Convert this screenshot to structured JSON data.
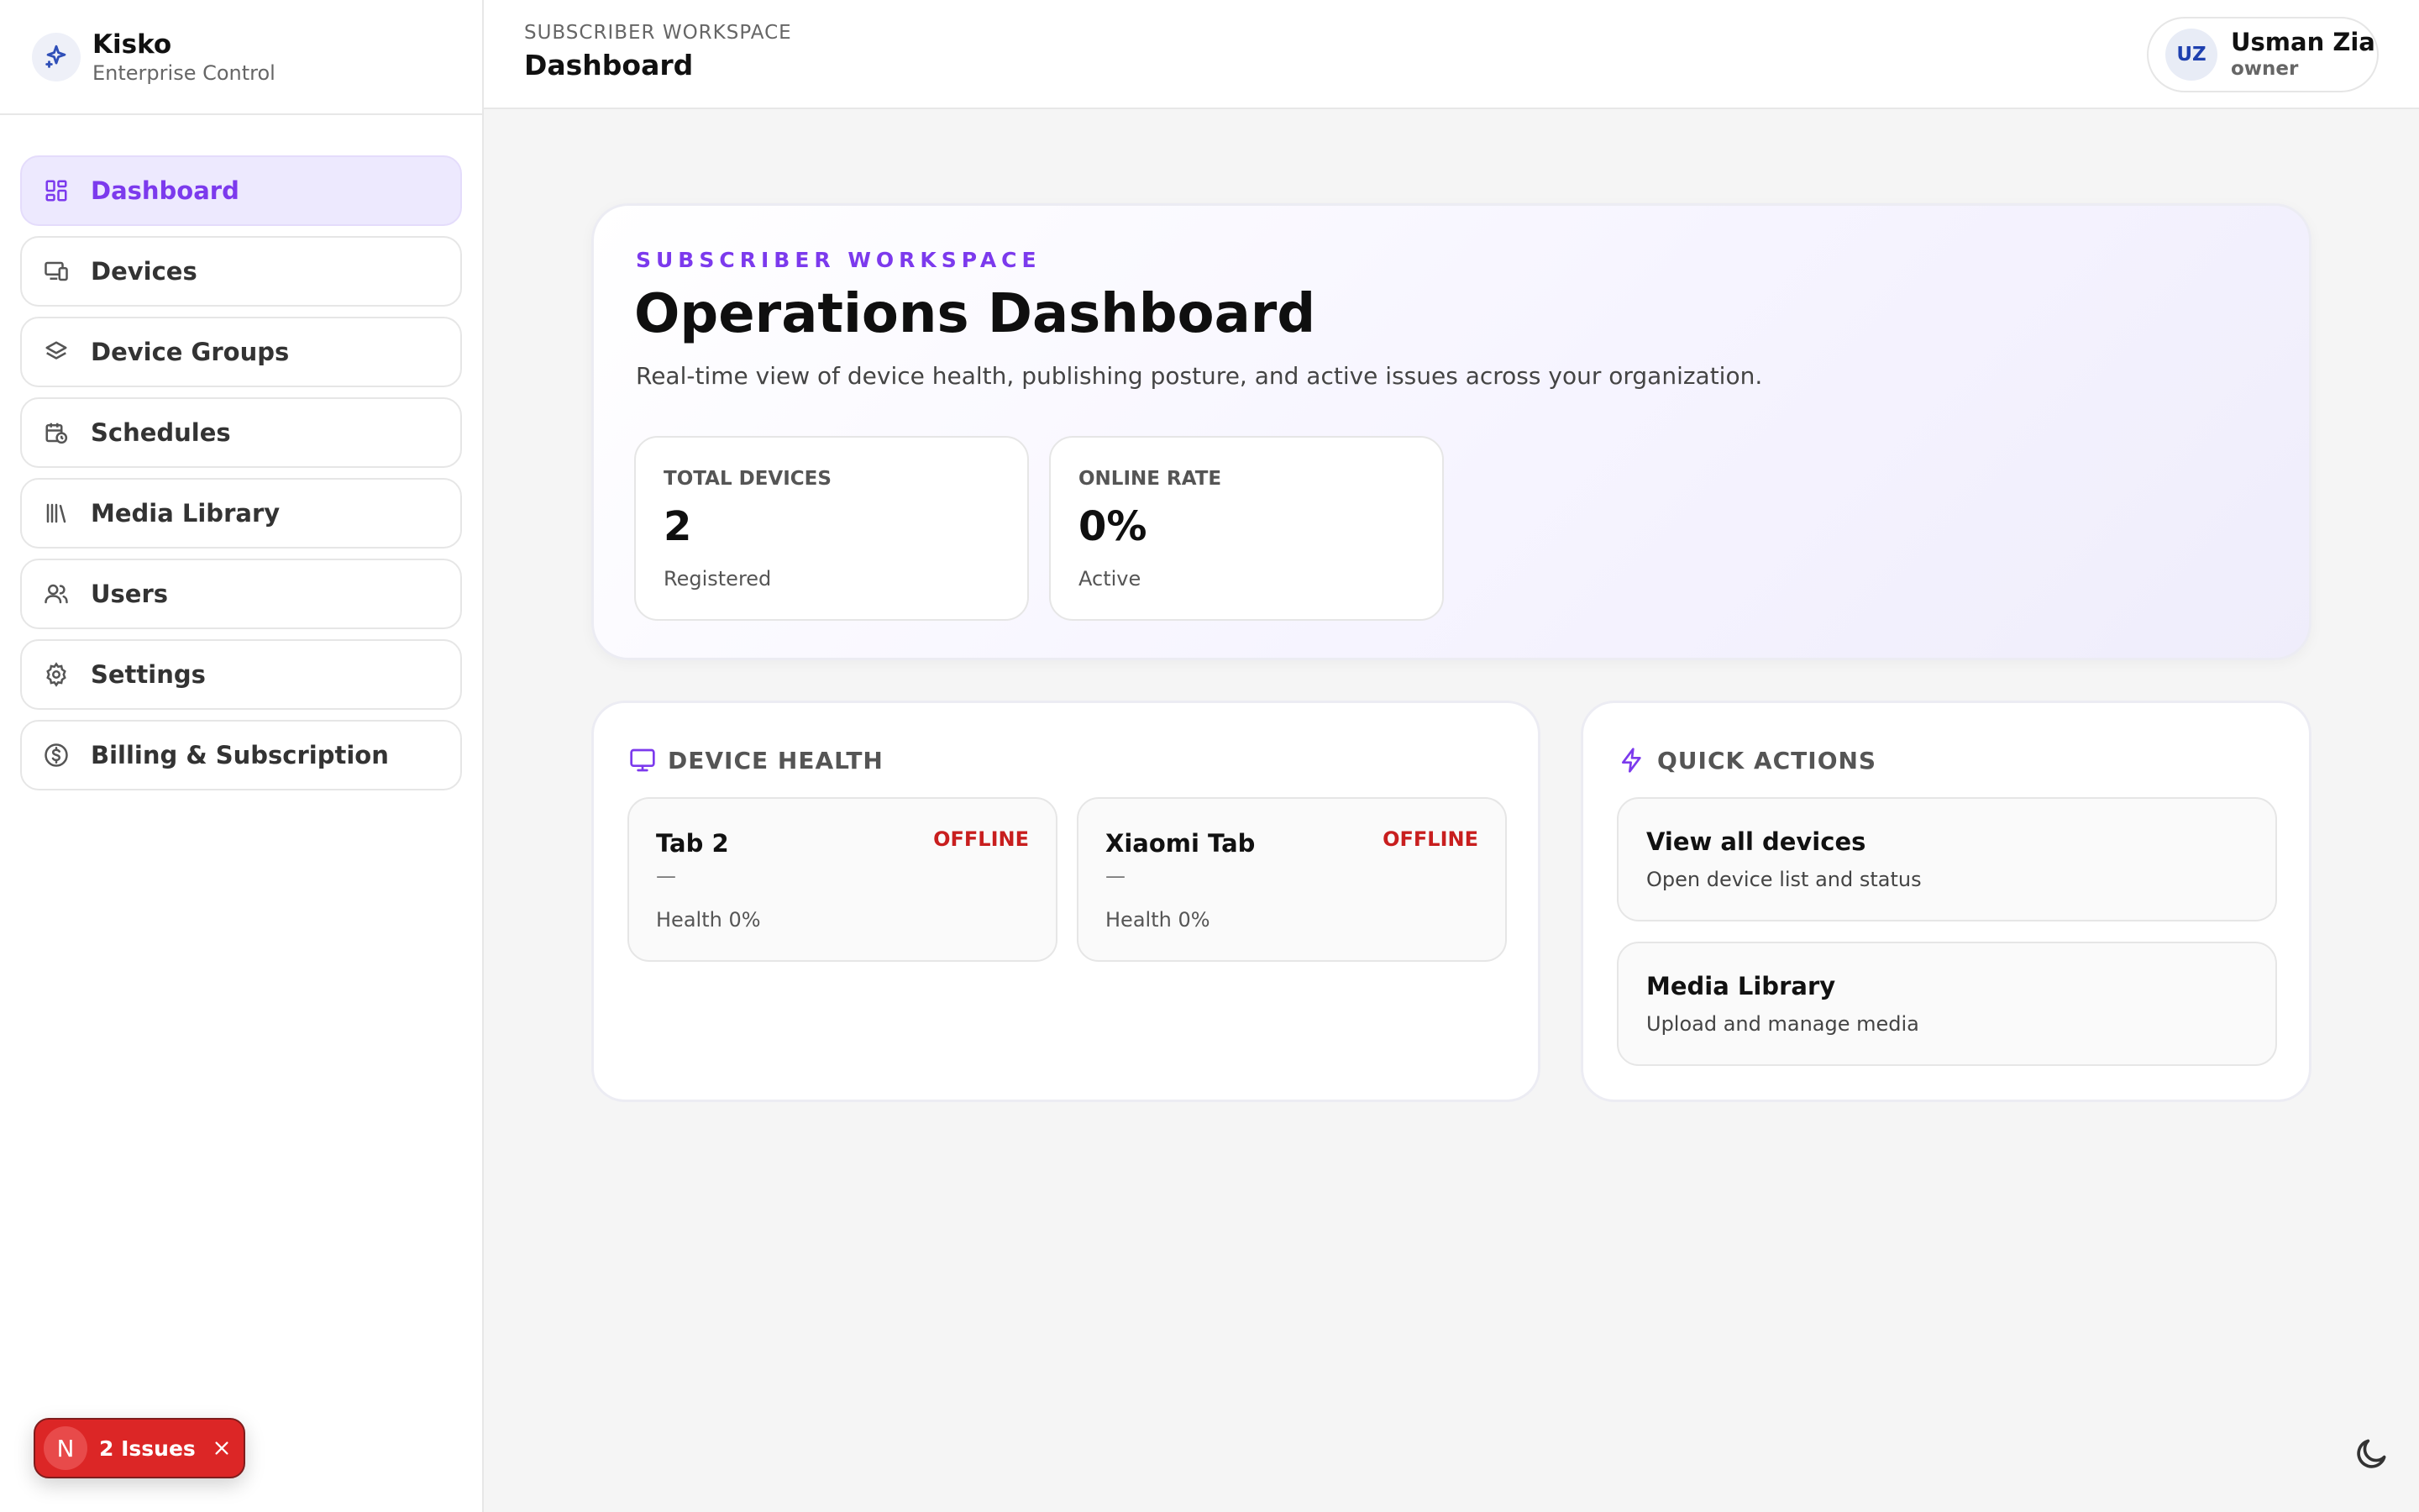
{
  "app": {
    "name": "Kisko",
    "subtitle": "Enterprise Control"
  },
  "sidebar": {
    "items": [
      {
        "label": "Dashboard",
        "icon": "dashboard-icon",
        "active": true
      },
      {
        "label": "Devices",
        "icon": "devices-icon"
      },
      {
        "label": "Device Groups",
        "icon": "layers-icon"
      },
      {
        "label": "Schedules",
        "icon": "calendar-clock-icon"
      },
      {
        "label": "Media Library",
        "icon": "library-icon"
      },
      {
        "label": "Users",
        "icon": "users-icon"
      },
      {
        "label": "Settings",
        "icon": "gear-icon"
      },
      {
        "label": "Billing & Subscription",
        "icon": "dollar-circle-icon"
      }
    ]
  },
  "issues": {
    "badge_letter": "N",
    "label": "2 Issues"
  },
  "topbar": {
    "breadcrumb": "SUBSCRIBER WORKSPACE",
    "title": "Dashboard",
    "user": {
      "initials": "UZ",
      "name": "Usman Zia",
      "role": "owner"
    }
  },
  "hero": {
    "eyebrow": "SUBSCRIBER WORKSPACE",
    "title": "Operations Dashboard",
    "description": "Real-time view of device health, publishing posture, and active issues across your organization.",
    "stats": [
      {
        "label": "TOTAL DEVICES",
        "value": "2",
        "sub": "Registered"
      },
      {
        "label": "ONLINE RATE",
        "value": "0%",
        "sub": "Active"
      }
    ]
  },
  "device_health": {
    "title": "DEVICE HEALTH",
    "devices": [
      {
        "name": "Tab 2",
        "status": "OFFLINE",
        "detail": "—",
        "health": "Health 0%"
      },
      {
        "name": "Xiaomi Tab",
        "status": "OFFLINE",
        "detail": "—",
        "health": "Health 0%"
      }
    ]
  },
  "quick_actions": {
    "title": "QUICK ACTIONS",
    "actions": [
      {
        "title": "View all devices",
        "desc": "Open device list and status"
      },
      {
        "title": "Media Library",
        "desc": "Upload and manage media"
      }
    ]
  },
  "colors": {
    "accent": "#7c3aed",
    "offline": "#c81e1e",
    "issues": "#dc2626"
  }
}
